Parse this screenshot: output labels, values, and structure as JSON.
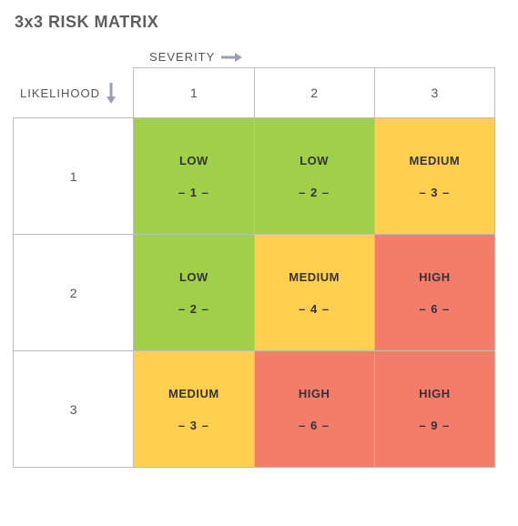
{
  "title": "3x3 RISK MATRIX",
  "axis": {
    "severity": "SEVERITY",
    "likelihood": "LIKELIHOOD"
  },
  "severity_headers": [
    "1",
    "2",
    "3"
  ],
  "likelihood_headers": [
    "1",
    "2",
    "3"
  ],
  "cells": {
    "r1": [
      {
        "label": "LOW",
        "score": "– 1 –",
        "level": "low"
      },
      {
        "label": "LOW",
        "score": "– 2 –",
        "level": "low"
      },
      {
        "label": "MEDIUM",
        "score": "– 3 –",
        "level": "medium"
      }
    ],
    "r2": [
      {
        "label": "LOW",
        "score": "– 2 –",
        "level": "low"
      },
      {
        "label": "MEDIUM",
        "score": "– 4 –",
        "level": "medium"
      },
      {
        "label": "HIGH",
        "score": "– 6 –",
        "level": "high"
      }
    ],
    "r3": [
      {
        "label": "MEDIUM",
        "score": "– 3 –",
        "level": "medium"
      },
      {
        "label": "HIGH",
        "score": "– 6 –",
        "level": "high"
      },
      {
        "label": "HIGH",
        "score": "– 9 –",
        "level": "high"
      }
    ]
  },
  "colors": {
    "low": "#a0d047",
    "medium": "#ffcf4d",
    "high": "#f47c6a"
  },
  "chart_data": {
    "type": "heatmap",
    "title": "3x3 RISK MATRIX",
    "xlabel": "SEVERITY",
    "ylabel": "LIKELIHOOD",
    "x": [
      1,
      2,
      3
    ],
    "y": [
      1,
      2,
      3
    ],
    "values": [
      [
        1,
        2,
        3
      ],
      [
        2,
        4,
        6
      ],
      [
        3,
        6,
        9
      ]
    ],
    "levels": [
      [
        "LOW",
        "LOW",
        "MEDIUM"
      ],
      [
        "LOW",
        "MEDIUM",
        "HIGH"
      ],
      [
        "MEDIUM",
        "HIGH",
        "HIGH"
      ]
    ],
    "level_colors": {
      "LOW": "#a0d047",
      "MEDIUM": "#ffcf4d",
      "HIGH": "#f47c6a"
    }
  }
}
